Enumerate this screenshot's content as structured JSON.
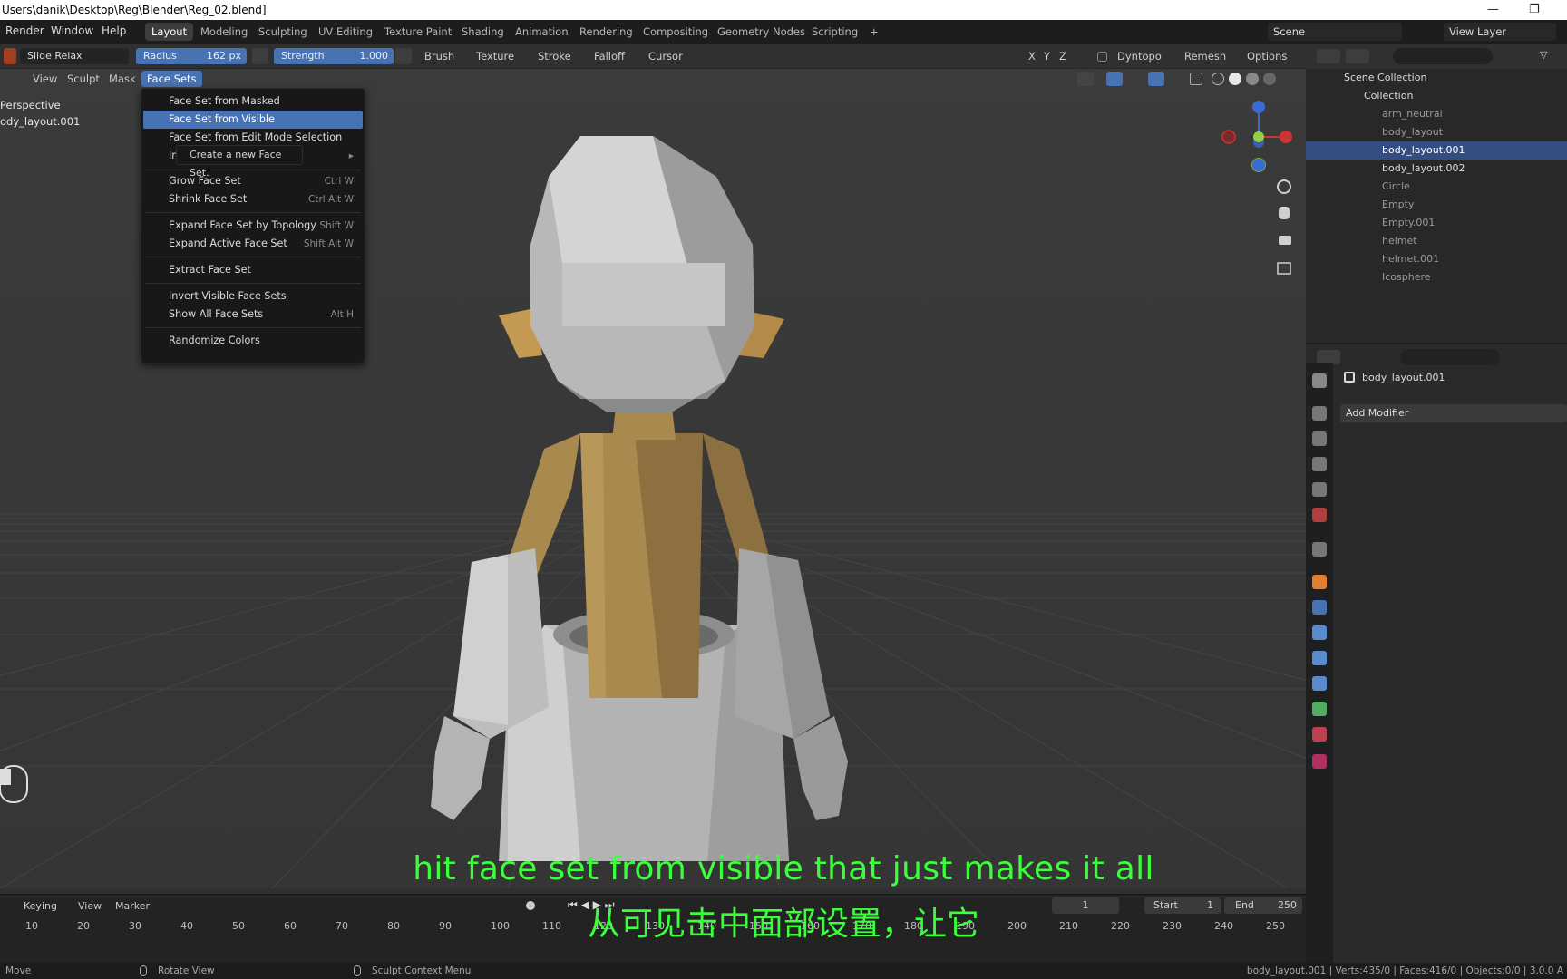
{
  "window": {
    "title": "Users\\danik\\Desktop\\Reg\\Blender\\Reg_02.blend]",
    "minimize": "—",
    "restore": "❐"
  },
  "menubar": {
    "items": [
      "Render",
      "Window",
      "Help"
    ]
  },
  "workspaces": [
    "Layout",
    "Modeling",
    "Sculpting",
    "UV Editing",
    "Texture Paint",
    "Shading",
    "Animation",
    "Rendering",
    "Compositing",
    "Geometry Nodes",
    "Scripting",
    "+"
  ],
  "scene": {
    "label": "Scene",
    "view_layer": "View Layer"
  },
  "tool_header": {
    "brush_name": "Slide Relax",
    "radius_label": "Radius",
    "radius_value": "162 px",
    "strength_label": "Strength",
    "strength_value": "1.000",
    "dropdowns": [
      "Brush",
      "Texture",
      "Stroke",
      "Falloff",
      "Cursor"
    ],
    "axes": [
      "X",
      "Y",
      "Z"
    ],
    "dyntopo": "Dyntopo",
    "remesh": "Remesh",
    "options": "Options"
  },
  "viewport_header": {
    "items": [
      "View",
      "Sculpt",
      "Mask",
      "Face Sets"
    ]
  },
  "viewport_overlay": {
    "view_name": "Perspective",
    "object_name": "ody_layout.001"
  },
  "face_sets_menu": {
    "items": [
      {
        "label": "Face Set from Masked",
        "shortcut": ""
      },
      {
        "label": "Face Set from Visible",
        "shortcut": ""
      },
      {
        "label": "Face Set from Edit Mode Selection",
        "shortcut": ""
      },
      {
        "label": "Init",
        "shortcut": ""
      },
      {
        "label": "Grow Face Set",
        "shortcut": "Ctrl W"
      },
      {
        "label": "Shrink Face Set",
        "shortcut": "Ctrl Alt W"
      },
      {
        "label": "Expand Face Set by Topology",
        "shortcut": "Shift W"
      },
      {
        "label": "Expand Active Face Set",
        "shortcut": "Shift Alt W"
      },
      {
        "label": "Extract Face Set",
        "shortcut": ""
      },
      {
        "label": "Invert Visible Face Sets",
        "shortcut": ""
      },
      {
        "label": "Show All Face Sets",
        "shortcut": "Alt H"
      },
      {
        "label": "Randomize Colors",
        "shortcut": ""
      }
    ],
    "tooltip": "Create a new Face Set."
  },
  "outliner": {
    "scene_collection": "Scene Collection",
    "collection": "Collection",
    "objects": [
      {
        "name": "arm_neutral",
        "selected": false
      },
      {
        "name": "body_layout",
        "selected": false
      },
      {
        "name": "body_layout.001",
        "selected": true
      },
      {
        "name": "body_layout.002",
        "selected": false
      },
      {
        "name": "Circle",
        "selected": false
      },
      {
        "name": "Empty",
        "selected": false
      },
      {
        "name": "Empty.001",
        "selected": false
      },
      {
        "name": "helmet",
        "selected": false
      },
      {
        "name": "helmet.001",
        "selected": false
      },
      {
        "name": "Icosphere",
        "selected": false
      }
    ]
  },
  "properties": {
    "object_name": "body_layout.001",
    "add_modifier": "Add Modifier"
  },
  "timeline": {
    "menu": [
      "Keying",
      "View",
      "Marker"
    ],
    "current_frame": "1",
    "start_label": "Start",
    "start_value": "1",
    "end_label": "End",
    "end_value": "250",
    "ticks": [
      "10",
      "20",
      "30",
      "40",
      "50",
      "60",
      "70",
      "80",
      "90",
      "100",
      "110",
      "120",
      "130",
      "140",
      "150",
      "160",
      "170",
      "180",
      "190",
      "200",
      "210",
      "220",
      "230",
      "240",
      "250"
    ]
  },
  "statusbar": {
    "move": "Move",
    "rotate": "Rotate View",
    "context": "Sculpt Context Menu",
    "stats": "body_layout.001 | Verts:435/0 | Faces:416/0 | Objects:0/0 | 3.0.0 A"
  },
  "subtitles": {
    "en": "hit face set from visible that just makes it all",
    "zh": "从可见击中面部设置，让它"
  },
  "colors": {
    "accent": "#4772b3",
    "subtitle": "#3cff3c",
    "body_tan": "#a8894e",
    "body_grey": "#bcbcbc"
  }
}
